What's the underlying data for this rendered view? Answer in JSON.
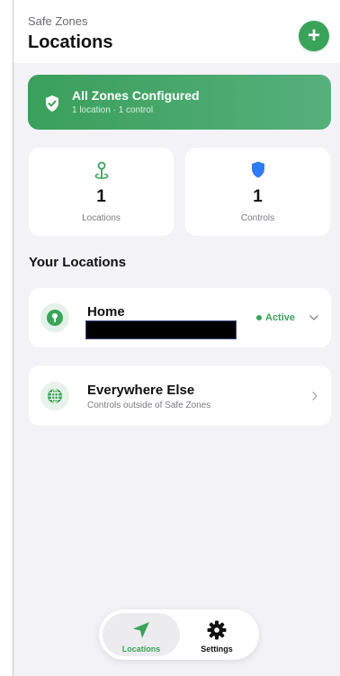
{
  "header": {
    "subtitle": "Safe Zones",
    "title": "Locations",
    "add_label": "+"
  },
  "banner": {
    "title": "All Zones Configured",
    "subtitle": "1 location · 1 control",
    "icon": "shield-check-icon"
  },
  "stats": [
    {
      "value": "1",
      "label": "Locations",
      "icon": "location-pin-icon",
      "color": "#3aa35a"
    },
    {
      "value": "1",
      "label": "Controls",
      "icon": "shield-icon",
      "color": "#2f7bf5"
    }
  ],
  "section_title": "Your Locations",
  "locations": [
    {
      "name": "Home",
      "status": "Active",
      "icon": "pin-icon"
    },
    {
      "name": "Everywhere Else",
      "description": "Controls outside of Safe Zones",
      "icon": "globe-icon"
    }
  ],
  "tabs": [
    {
      "label": "Locations",
      "icon": "navigation-arrow-icon",
      "active": true
    },
    {
      "label": "Settings",
      "icon": "gear-icon",
      "active": false
    }
  ],
  "colors": {
    "accent": "#3aa35a",
    "controls_blue": "#2f7bf5",
    "background": "#f2f2f7"
  }
}
